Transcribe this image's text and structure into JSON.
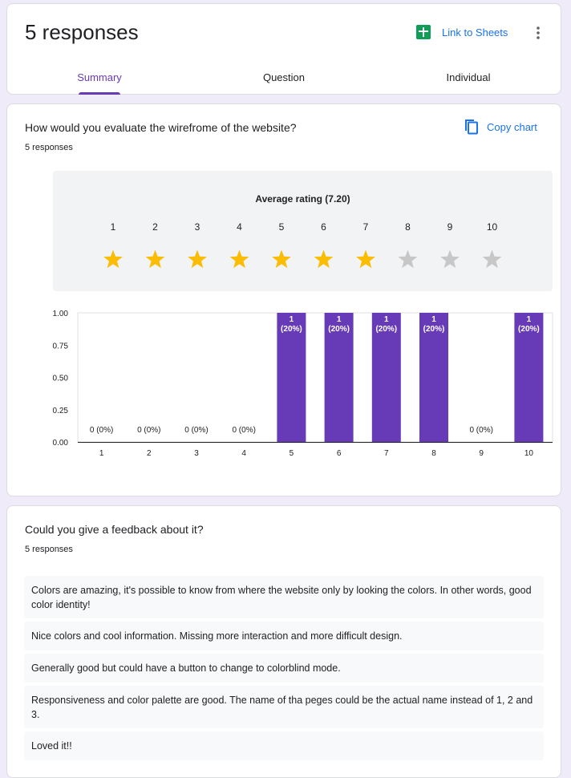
{
  "header": {
    "title": "5 responses",
    "link_sheets_label": "Link to Sheets",
    "tabs": [
      {
        "label": "Summary",
        "active": true
      },
      {
        "label": "Question",
        "active": false
      },
      {
        "label": "Individual",
        "active": false
      }
    ]
  },
  "question1": {
    "title": "How would you evaluate the wirefrome of the website?",
    "response_count": "5 responses",
    "copy_chart_label": "Copy chart",
    "average_rating_label": "Average rating (7.20)",
    "star_numbers": [
      "1",
      "2",
      "3",
      "4",
      "5",
      "6",
      "7",
      "8",
      "9",
      "10"
    ],
    "filled_stars": 7,
    "total_stars": 10,
    "colors": {
      "star_filled": "#fbbc04",
      "star_empty": "#c7c7c7",
      "bar": "#673ab7"
    }
  },
  "chart_data": {
    "type": "bar",
    "categories": [
      "1",
      "2",
      "3",
      "4",
      "5",
      "6",
      "7",
      "8",
      "9",
      "10"
    ],
    "values": [
      0,
      0,
      0,
      0,
      1,
      1,
      1,
      1,
      0,
      1
    ],
    "value_labels": [
      "0 (0%)",
      "0 (0%)",
      "0 (0%)",
      "0 (0%)",
      "1\n(20%)",
      "1\n(20%)",
      "1\n(20%)",
      "1\n(20%)",
      "0 (0%)",
      "1\n(20%)"
    ],
    "yticks": [
      "0.00",
      "0.25",
      "0.50",
      "0.75",
      "1.00"
    ],
    "ylim": [
      0,
      1
    ],
    "xlabel": "",
    "ylabel": "",
    "title": ""
  },
  "question2": {
    "title": "Could you give a feedback about it?",
    "response_count": "5 responses",
    "responses": [
      "Colors are amazing, it's possible to know from where the website only by looking the colors. In other words, good color identity!",
      "Nice colors and cool information. Missing more interaction and more difficult design.",
      "Generally good but could have a button to change to colorblind mode.",
      "Responsiveness and color palette are good. The name of tha peges could be the actual name instead of 1, 2 and 3.",
      "Loved it!!"
    ]
  }
}
